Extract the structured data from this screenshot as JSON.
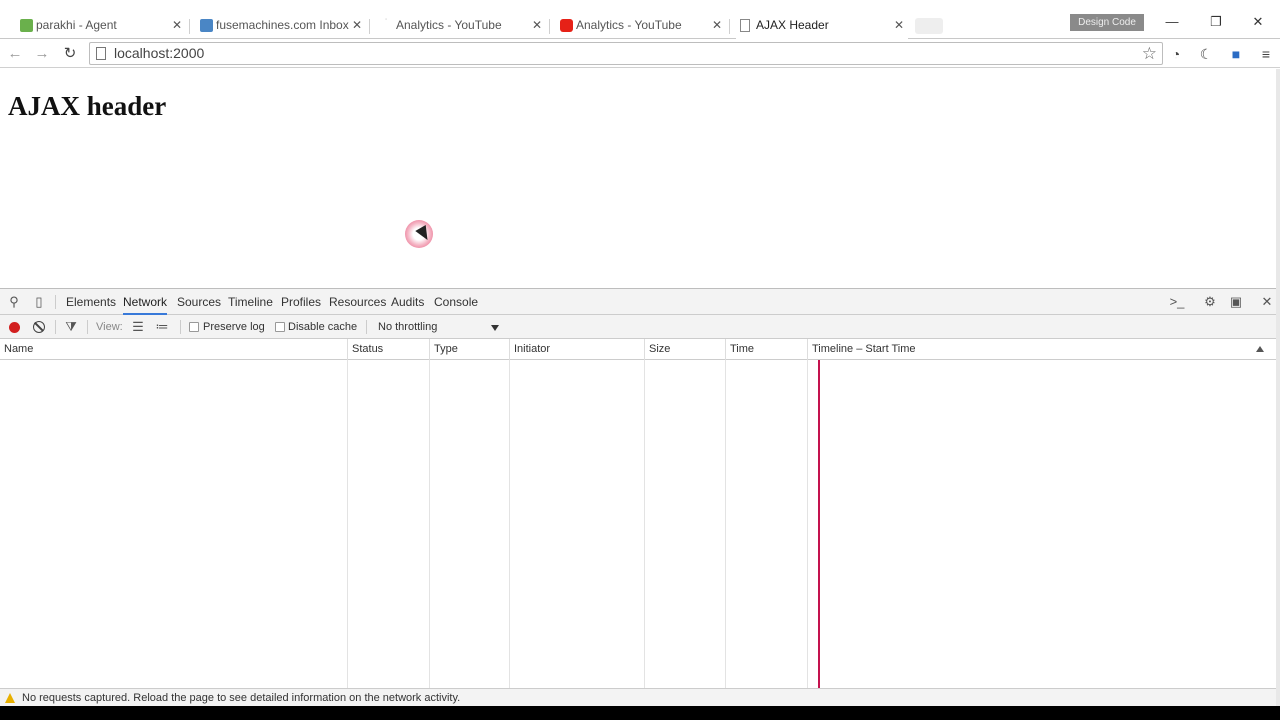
{
  "browser": {
    "tabs": [
      {
        "title": "parakhi - Agent",
        "favicon": "green-agent-icon",
        "fav_color": "#6ab04c"
      },
      {
        "title": "fusemachines.com Inbox",
        "favicon": "mail-icon",
        "fav_color": "#4a86c5"
      },
      {
        "title": "Analytics - YouTube",
        "favicon": "loading-icon",
        "fav_color": "#aaaaaa"
      },
      {
        "title": "Analytics - YouTube",
        "favicon": "youtube-icon",
        "fav_color": "#e62117"
      },
      {
        "title": "AJAX Header",
        "favicon": "page-icon",
        "fav_color": "#888888"
      }
    ],
    "design_badge": "Design Code",
    "window_buttons": {
      "minimize": "—",
      "restore": "❐",
      "close": "✕"
    },
    "url": "localhost:2000"
  },
  "page": {
    "heading": "AJAX header"
  },
  "devtools": {
    "tabs": [
      "Elements",
      "Network",
      "Sources",
      "Timeline",
      "Profiles",
      "Resources",
      "Audits",
      "Console"
    ],
    "active_tab": "Network",
    "toolbar": {
      "view_label": "View:",
      "preserve_log": "Preserve log",
      "disable_cache": "Disable cache",
      "throttling": "No throttling"
    },
    "columns": [
      "Name",
      "Status",
      "Type",
      "Initiator",
      "Size",
      "Time",
      "Timeline – Start Time"
    ],
    "status_message": "No requests captured. Reload the page to see detailed information on the network activity.",
    "accent": "#3879d9",
    "load_line_color": "#c4124e"
  }
}
